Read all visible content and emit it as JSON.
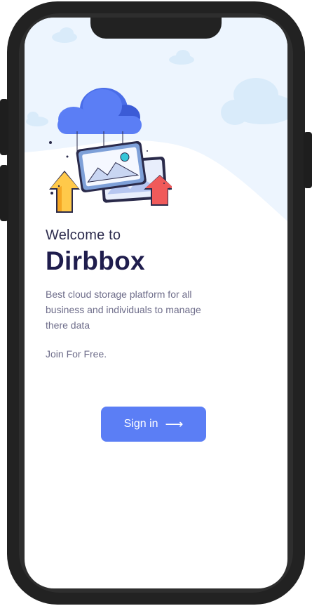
{
  "welcome": {
    "greeting": "Welcome to",
    "app_name": "Dirbbox",
    "description": "Best cloud storage platform for all business and individuals to manage there data",
    "join_text": "Join For Free."
  },
  "signin": {
    "label": "Sign in",
    "arrow_icon": "arrow-right-icon"
  },
  "colors": {
    "accent": "#5b7ef5",
    "title": "#1f1d4d",
    "body_text": "#6e6d8a",
    "hero_bg": "#edf5fe"
  },
  "icons": {
    "illustration": "cloud-upload-illustration"
  }
}
